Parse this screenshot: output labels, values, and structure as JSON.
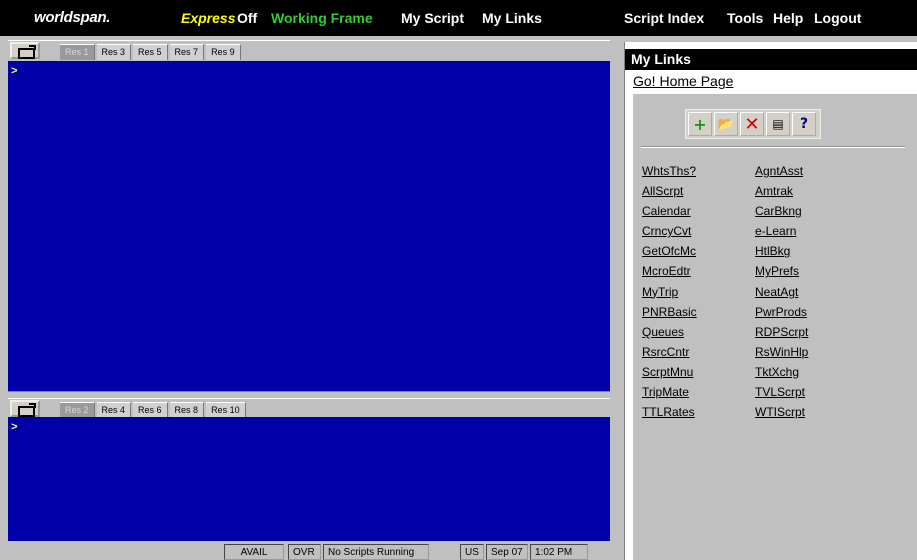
{
  "topbar": {
    "logo": "worldspan.",
    "express": "Express",
    "express_state": "Off",
    "working_frame": "Working Frame",
    "my_script": "My Script",
    "my_links": "My Links",
    "script_index": "Script Index",
    "tools": "Tools",
    "help": "Help",
    "logout": "Logout"
  },
  "top_pane": {
    "tabs": [
      "Res 1",
      "Res 3",
      "Res 5",
      "Res 7",
      "Res 9"
    ],
    "prompt": ">"
  },
  "bottom_pane": {
    "tabs": [
      "Res 2",
      "Res 4",
      "Res 6",
      "Res 8",
      "Res 10"
    ],
    "prompt": ">"
  },
  "status": {
    "avail": "AVAIL",
    "ovr": "OVR",
    "scripts": "No Scripts Running",
    "region": "US",
    "date": "Sep 07",
    "time": "1:02 PM"
  },
  "my_links_panel": {
    "title": "My Links",
    "home_link": "Go! Home Page",
    "left_links": [
      "WhtsThs?",
      "AllScrpt",
      "Calendar",
      "CrncyCvt",
      "GetOfcMc",
      "McroEdtr",
      "MyTrip",
      "PNRBasic",
      "Queues",
      "RsrcCntr",
      "ScrptMnu",
      "TripMate",
      "TTLRates"
    ],
    "right_links": [
      "AgntAsst",
      "Amtrak",
      "CarBkng",
      "e-Learn",
      "HtlBkg",
      "MyPrefs",
      "NeatAgt",
      "PwrProds",
      "RDPScrpt",
      "RsWinHlp",
      "TktXchg",
      "TVLScrpt",
      "WTIScrpt"
    ]
  },
  "colors": {
    "screen_bg": "#0000a8",
    "express": "#ffff00",
    "working_frame": "#33cc33"
  }
}
